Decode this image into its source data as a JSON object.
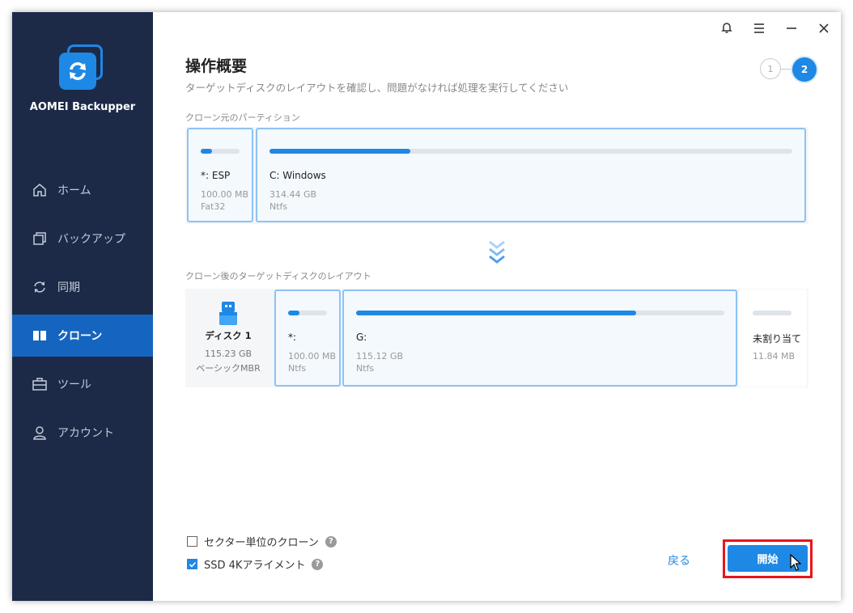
{
  "app": {
    "name": "AOMEI Backupper"
  },
  "nav": [
    {
      "label": "ホーム",
      "icon": "home-icon"
    },
    {
      "label": "バックアップ",
      "icon": "backup-icon"
    },
    {
      "label": "同期",
      "icon": "sync-icon"
    },
    {
      "label": "クローン",
      "icon": "clone-icon",
      "active": true
    },
    {
      "label": "ツール",
      "icon": "tools-icon"
    },
    {
      "label": "アカウント",
      "icon": "account-icon"
    }
  ],
  "page": {
    "title": "操作概要",
    "subtitle": "ターゲットディスクのレイアウトを確認し、問題がなければ処理を実行してください",
    "steps": [
      "1",
      "2"
    ],
    "current_step": 2
  },
  "source": {
    "label": "クローン元のパーティション",
    "partitions": [
      {
        "name": "*: ESP",
        "size": "100.00 MB",
        "fs": "Fat32",
        "used_fraction": 0.3
      },
      {
        "name": "C: Windows",
        "size": "314.44 GB",
        "fs": "Ntfs",
        "used_fraction": 0.27
      }
    ]
  },
  "target": {
    "label": "クローン後のターゲットディスクのレイアウト",
    "disk": {
      "name": "ディスク 1",
      "size": "115.23 GB",
      "type": "ベーシックMBR"
    },
    "partitions": [
      {
        "name": "*:",
        "size": "100.00 MB",
        "fs": "Ntfs",
        "used_fraction": 0.3
      },
      {
        "name": "G:",
        "size": "115.12 GB",
        "fs": "Ntfs",
        "used_fraction": 0.76
      }
    ],
    "unallocated": {
      "name": "未割り当て",
      "size": "11.84 MB"
    }
  },
  "options": {
    "sector": {
      "label": "セクター単位のクローン",
      "checked": false
    },
    "ssd": {
      "label": "SSD 4Kアライメント",
      "checked": true
    },
    "help_glyph": "?"
  },
  "actions": {
    "back": "戻る",
    "start": "開始"
  },
  "colors": {
    "accent": "#1e88e5",
    "sidebar": "#1c2a48",
    "highlight": "#e8141c"
  }
}
